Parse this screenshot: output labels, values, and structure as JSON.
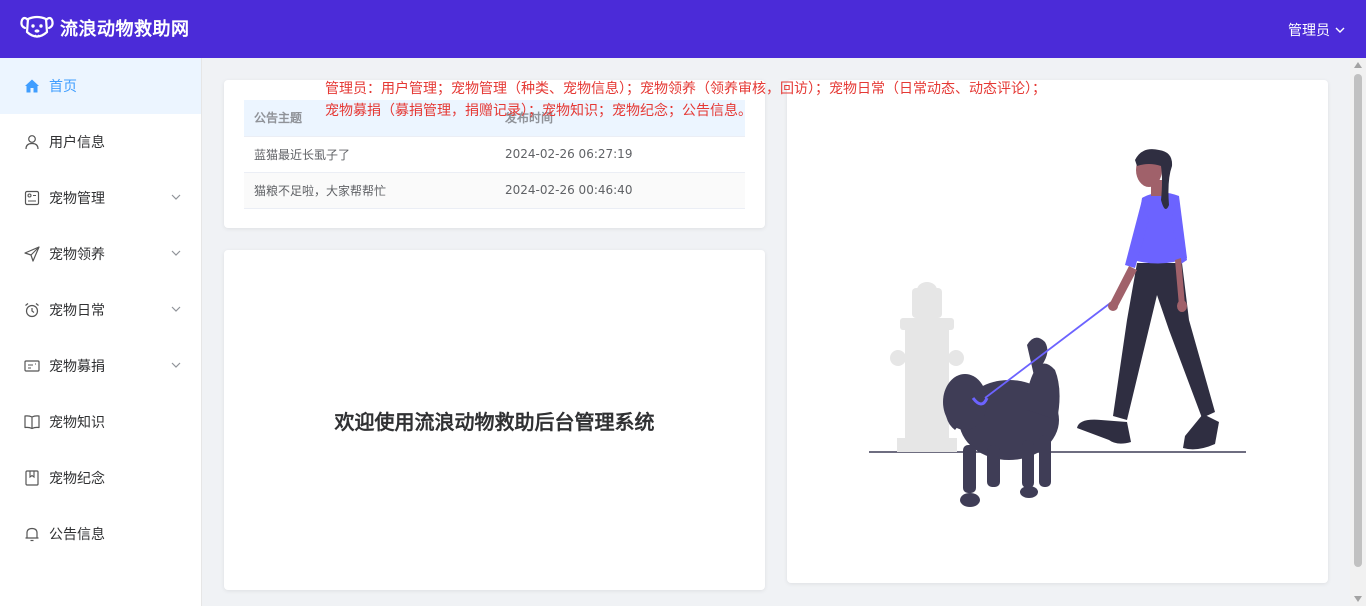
{
  "header": {
    "title": "流浪动物救助网",
    "user_label": "管理员",
    "brand_color": "#4b2bd8"
  },
  "sidebar": {
    "items": [
      {
        "label": "首页",
        "icon": "home-icon",
        "active": true
      },
      {
        "label": "用户信息",
        "icon": "user-icon"
      },
      {
        "label": "宠物管理",
        "icon": "pet-manage-icon",
        "expandable": true
      },
      {
        "label": "宠物领养",
        "icon": "send-icon",
        "expandable": true
      },
      {
        "label": "宠物日常",
        "icon": "alarm-clock-icon",
        "expandable": true
      },
      {
        "label": "宠物募捐",
        "icon": "ticket-icon",
        "expandable": true
      },
      {
        "label": "宠物知识",
        "icon": "book-icon"
      },
      {
        "label": "宠物纪念",
        "icon": "notebook-icon"
      },
      {
        "label": "公告信息",
        "icon": "bell-icon"
      }
    ]
  },
  "notice_table": {
    "headers": [
      "公告主题",
      "发布时间"
    ],
    "rows": [
      {
        "title": "蓝猫最近长虱子了",
        "time": "2024-02-26 06:27:19"
      },
      {
        "title": "猫粮不足啦，大家帮帮忙",
        "time": "2024-02-26 00:46:40"
      }
    ]
  },
  "welcome": {
    "text": "欢迎使用流浪动物救助后台管理系统"
  },
  "role_note": {
    "line1": "管理员：用户管理；宠物管理（种类、宠物信息）；宠物领养（领养审核，回访）；宠物日常（日常动态、动态评论）；",
    "line2": "宠物募捐（募捐管理，捐赠记录）；宠物知识；宠物纪念；公告信息。",
    "color": "#e53935"
  },
  "illustration": {
    "icon": "woman-walking-dog-illustration",
    "accent": "#6c63ff"
  }
}
